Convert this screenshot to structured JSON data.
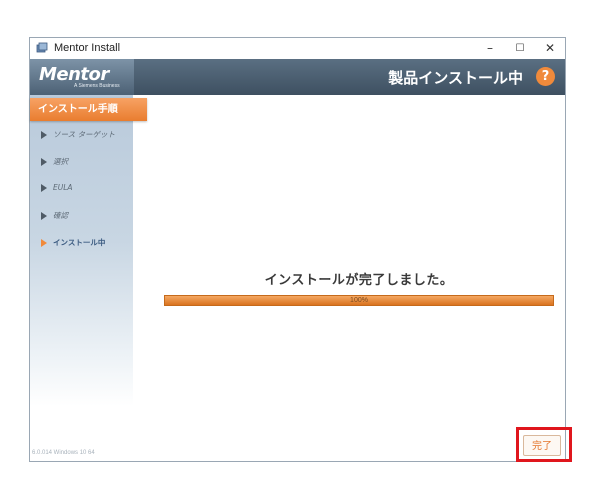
{
  "window": {
    "title": "Mentor Install",
    "controls": {
      "minimize": "–",
      "maximize": "☐",
      "close": "✕"
    }
  },
  "header": {
    "logo": "Mentor",
    "logo_tagline": "A Siemens Business",
    "title": "製品インストール中",
    "help_label": "?"
  },
  "sidebar": {
    "heading": "インストール手順",
    "steps": [
      {
        "label": "ソース ターゲット",
        "active": false
      },
      {
        "label": "選択",
        "active": false
      },
      {
        "label": "EULA",
        "active": false
      },
      {
        "label": "確認",
        "active": false
      },
      {
        "label": "インストール中",
        "active": true
      }
    ],
    "version": "6.0.014  Windows 10 64"
  },
  "main": {
    "message": "インストールが完了しました。",
    "progress": {
      "value": 1.0,
      "label": "100%"
    }
  },
  "footer": {
    "finish_label": "完了"
  },
  "colors": {
    "accent": "#f08a3b",
    "header_bg": "#3e5061",
    "highlight": "#e0161d"
  },
  "icons": {
    "app": "installer-icon",
    "help": "help-icon",
    "step": "triangle-right-icon"
  }
}
